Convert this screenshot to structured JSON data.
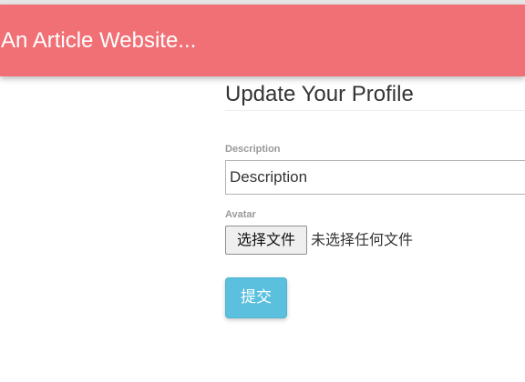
{
  "navbar": {
    "brand": "An Article Website..."
  },
  "page": {
    "title": "Update Your Profile"
  },
  "form": {
    "description": {
      "label": "Description",
      "placeholder": "Description",
      "value": ""
    },
    "avatar": {
      "label": "Avatar",
      "button_label": "选择文件",
      "status": "未选择任何文件"
    },
    "submit_label": "提交"
  },
  "colors": {
    "navbar_bg": "#f07075",
    "submit_bg": "#5bc0de"
  }
}
